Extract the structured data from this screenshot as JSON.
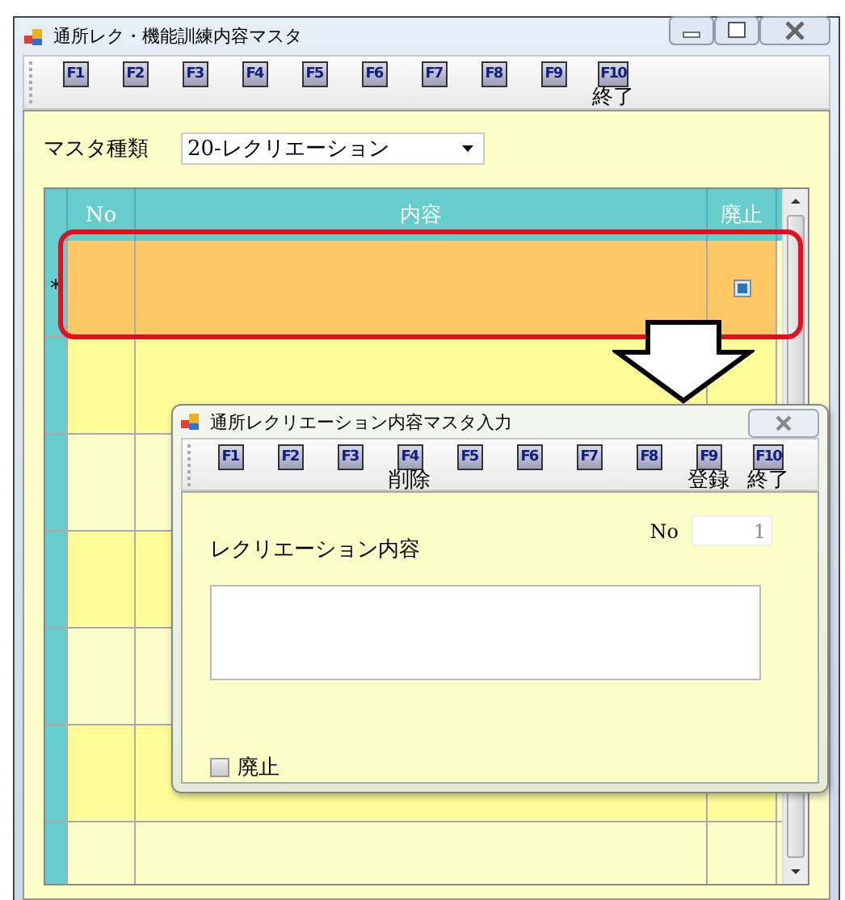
{
  "window": {
    "title": "通所レク・機能訓練内容マスタ"
  },
  "toolbar": [
    {
      "key": "F1"
    },
    {
      "key": "F2"
    },
    {
      "key": "F3"
    },
    {
      "key": "F4"
    },
    {
      "key": "F5"
    },
    {
      "key": "F6"
    },
    {
      "key": "F7"
    },
    {
      "key": "F8"
    },
    {
      "key": "F9"
    },
    {
      "key": "F10",
      "label": "終了"
    }
  ],
  "master_type": {
    "label": "マスタ種類",
    "value": "20-レクリエーション"
  },
  "grid": {
    "columns": [
      "No",
      "内容",
      "廃止"
    ],
    "rows": [
      {
        "kind": "new",
        "marker": "*",
        "selected": true
      },
      {
        "kind": "empty",
        "selected": false
      },
      {
        "kind": "empty",
        "selected": false
      },
      {
        "kind": "empty",
        "selected": false
      },
      {
        "kind": "empty",
        "selected": false
      },
      {
        "kind": "empty",
        "selected": false
      },
      {
        "kind": "empty",
        "selected": false
      }
    ]
  },
  "dialog": {
    "title": "通所レクリエーション内容マスタ入力",
    "toolbar": [
      {
        "key": "F1"
      },
      {
        "key": "F2"
      },
      {
        "key": "F3"
      },
      {
        "key": "F4",
        "label": "削除"
      },
      {
        "key": "F5"
      },
      {
        "key": "F6"
      },
      {
        "key": "F7"
      },
      {
        "key": "F8"
      },
      {
        "key": "F9",
        "label": "登録"
      },
      {
        "key": "F10",
        "label": "終了"
      }
    ],
    "content_label": "レクリエーション内容",
    "no_label": "No",
    "no_value": "1",
    "abolished": {
      "label": "廃止",
      "checked": false
    }
  },
  "annotations": [
    {
      "kind": "highlight"
    },
    {
      "kind": "arrow"
    }
  ]
}
